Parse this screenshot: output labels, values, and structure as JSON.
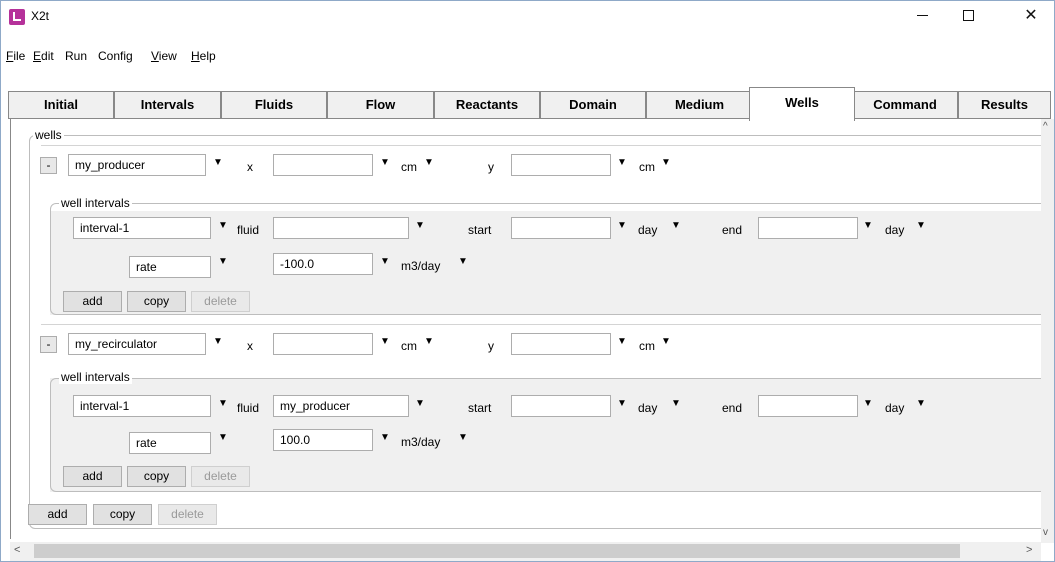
{
  "window": {
    "title": "X2t"
  },
  "window_controls": {
    "minimize": "—",
    "maximize": "☐",
    "close": "✕"
  },
  "menu": [
    {
      "label": "File",
      "u": "F",
      "rest": "ile"
    },
    {
      "label": "Edit",
      "u": "E",
      "rest": "dit"
    },
    {
      "label": "Run",
      "u": "",
      "rest": "Run"
    },
    {
      "label": "Config",
      "u": "",
      "rest": "Config"
    },
    {
      "label": "View",
      "u": "V",
      "rest": "iew"
    },
    {
      "label": "Help",
      "u": "H",
      "rest": "elp"
    }
  ],
  "tabs": [
    "Initial",
    "Intervals",
    "Fluids",
    "Flow",
    "Reactants",
    "Domain",
    "Medium",
    "Wells",
    "Command",
    "Results"
  ],
  "active_tab": "Wells",
  "wells_group_label": "wells",
  "well_intervals_label": "well intervals",
  "labels": {
    "x": "x",
    "y": "y",
    "fluid": "fluid",
    "start": "start",
    "end": "end"
  },
  "dropdown_glyph": "▼",
  "wells": [
    {
      "collapse": "-",
      "name": "my_producer",
      "x": "",
      "x_unit": "cm",
      "y": "",
      "y_unit": "cm",
      "interval": {
        "name": "interval-1",
        "fluid": "",
        "start": "",
        "start_unit": "day",
        "end": "",
        "end_unit": "day",
        "rate_type": "rate",
        "rate_value": "-100.0",
        "rate_unit": "m3/day"
      },
      "buttons": {
        "add": "add",
        "copy": "copy",
        "delete": "delete"
      }
    },
    {
      "collapse": "-",
      "name": "my_recirculator",
      "x": "",
      "x_unit": "cm",
      "y": "",
      "y_unit": "cm",
      "interval": {
        "name": "interval-1",
        "fluid": "my_producer",
        "start": "",
        "start_unit": "day",
        "end": "",
        "end_unit": "day",
        "rate_type": "rate",
        "rate_value": "100.0",
        "rate_unit": "m3/day"
      },
      "buttons": {
        "add": "add",
        "copy": "copy",
        "delete": "delete"
      }
    }
  ],
  "bottom_buttons": {
    "add": "add",
    "copy": "copy",
    "delete": "delete"
  },
  "scroll": {
    "up": "^",
    "down": "v",
    "left": "<",
    "right": ">"
  }
}
